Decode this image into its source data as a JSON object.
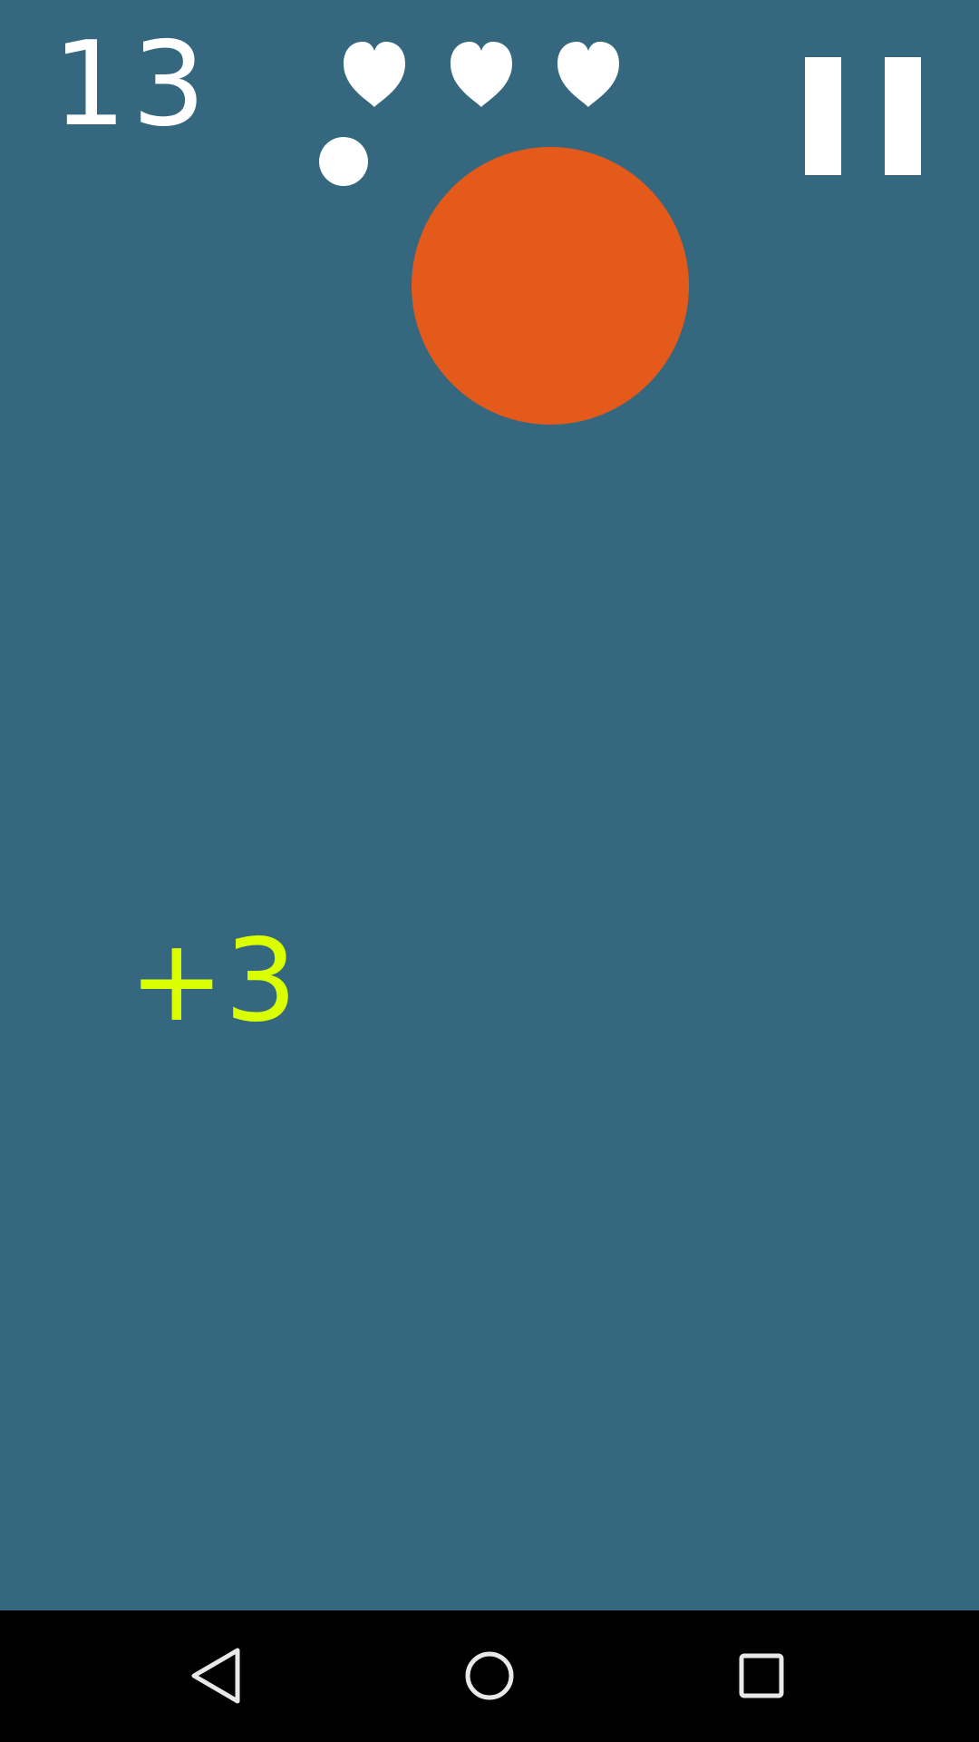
{
  "hud": {
    "score": "13",
    "lives": 3
  },
  "popup": {
    "text": "+3"
  },
  "colors": {
    "background": "#35687f",
    "text": "#ffffff",
    "ball": "#e45a1b",
    "popup": "#d9ff00",
    "navbar": "#000000",
    "nav_icon": "#e8e8e8"
  },
  "icons": {
    "lives": "heart-icon",
    "pause": "pause-icon",
    "back": "back-triangle-icon",
    "home": "home-circle-icon",
    "recents": "recents-square-icon"
  }
}
